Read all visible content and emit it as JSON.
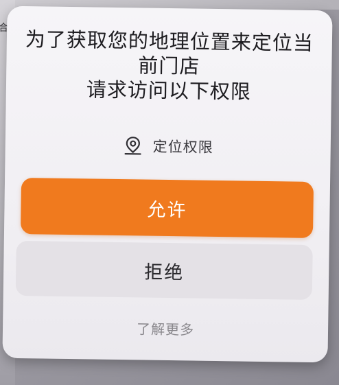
{
  "background": {
    "fragment_text": "合"
  },
  "dialog": {
    "title_lines": [
      "为了获取您的地理位置来定位当",
      "前门店",
      "请求访问以下权限"
    ],
    "permission": {
      "icon": "location-pin-icon",
      "label": "定位权限"
    },
    "allow_label": "允许",
    "deny_label": "拒绝",
    "learn_more_label": "了解更多"
  },
  "colors": {
    "accent": "#f07a1e",
    "deny_button": "#e4e1e6",
    "dialog_bg": "#f4f2f6"
  }
}
